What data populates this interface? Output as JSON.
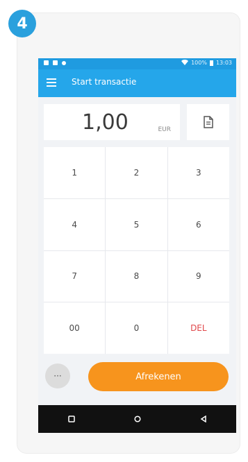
{
  "step": {
    "number": "4",
    "color": "#2aa0dd"
  },
  "statusbar": {
    "battery": "100%",
    "time": "13:03"
  },
  "appbar": {
    "title": "Start transactie"
  },
  "amount": {
    "value": "1,00",
    "currency": "EUR"
  },
  "keypad": {
    "keys": [
      "1",
      "2",
      "3",
      "4",
      "5",
      "6",
      "7",
      "8",
      "9",
      "00",
      "0",
      "DEL"
    ]
  },
  "actions": {
    "more_label": "···",
    "checkout_label": "Afrekenen"
  },
  "colors": {
    "primary": "#25a6ea",
    "accent": "#f7941d",
    "delete": "#e0484b"
  },
  "icons": {
    "menu": "hamburger-menu-icon",
    "document": "document-icon",
    "nav_recent": "square-icon",
    "nav_home": "circle-icon",
    "nav_back": "triangle-back-icon"
  }
}
